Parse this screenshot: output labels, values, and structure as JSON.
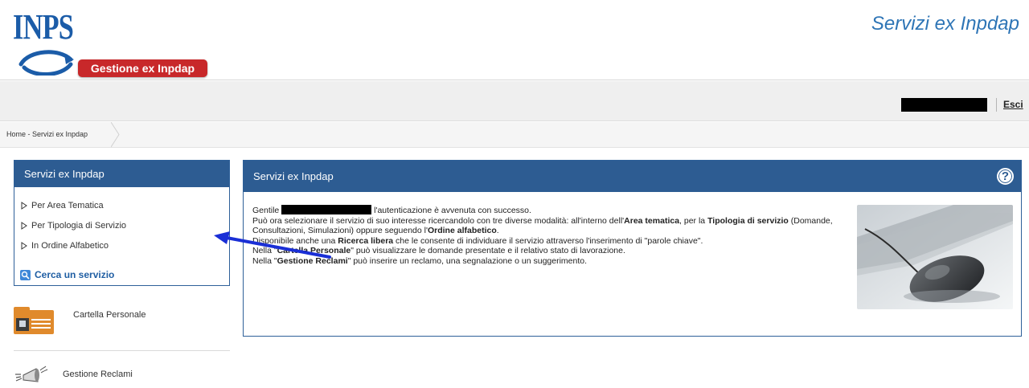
{
  "header": {
    "logo_text": "INPS",
    "logo_badge": "Gestione ex Inpdap",
    "site_title": "Servizi ex Inpdap"
  },
  "userbar": {
    "logout_label": "Esci"
  },
  "breadcrumb": {
    "label": "Home - Servizi ex Inpdap"
  },
  "sidebar": {
    "title": "Servizi ex Inpdap",
    "items": [
      {
        "label": "Per Area Tematica"
      },
      {
        "label": "Per Tipologia di Servizio"
      },
      {
        "label": "In Ordine Alfabetico"
      }
    ],
    "search_label": "Cerca un servizio",
    "cartella_label": "Cartella Personale",
    "reclami_label": "Gestione Reclami"
  },
  "main": {
    "title": "Servizi ex Inpdap",
    "help_symbol": "?",
    "p1_prefix": "Gentile",
    "p1_suffix": "l'autenticazione è avvenuta con successo.",
    "p2_a": "Può ora selezionare il servizio di suo interesse ricercandolo con tre diverse modalità: all'interno dell'",
    "p2_area": "Area tematica",
    "p2_b": ", per la ",
    "p2_tipologia": "Tipologia di servizio",
    "p2_c": " (Domande, Consultazioni, Simulazioni) oppure seguendo l'",
    "p2_ordine": "Ordine alfabetico",
    "p2_d": ".",
    "p3_a": "Disponibile anche una ",
    "p3_ricerca": "Ricerca libera",
    "p3_b": " che le consente di individuare il servizio attraverso l'inserimento di \"parole chiave\".",
    "p4_a": "Nella \"",
    "p4_cartella": "Cartella Personale",
    "p4_b": "\" può visualizzare le domande presentate e il relativo stato di lavorazione.",
    "p5_a": "Nella \"",
    "p5_reclami": "Gestione Reclami",
    "p5_b": "\" può inserire un reclamo, una segnalazione o un suggerimento."
  },
  "colors": {
    "header_blue": "#2d5c92",
    "title_blue": "#2e75b6",
    "badge_red": "#c8282a",
    "annotation_arrow": "#1a2fd6"
  },
  "icons": [
    "inps-logo-icon",
    "triangle-bullet-icon",
    "search-icon",
    "folder-card-icon",
    "megaphone-icon",
    "help-icon"
  ]
}
